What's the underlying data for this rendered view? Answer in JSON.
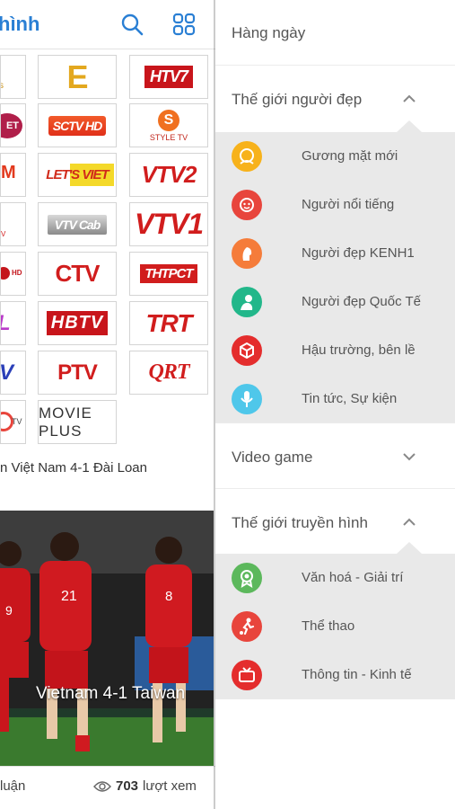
{
  "header": {
    "title": "hình"
  },
  "channels": {
    "row1": [
      "E",
      "HTV7"
    ],
    "row2": [
      "ET",
      "SCTV HD",
      "STYLE TV"
    ],
    "row3": [
      "M",
      "LET'S VIET",
      "VTV2"
    ],
    "row4": [
      "V",
      "VTV Cab",
      "VTV1"
    ],
    "row5": [
      "HD",
      "CTV",
      "THTPCT"
    ],
    "row6": [
      "L",
      "HBTV",
      "TRT"
    ],
    "row7": [
      "V",
      "PTV",
      "QRT"
    ],
    "row8": [
      "TV",
      "MOVIE PLUS"
    ]
  },
  "article": {
    "headline": "n Việt Nam 4-1 Đài Loan",
    "caption": "Vietnam 4-1 Taiwan",
    "comments_label": "luận",
    "views_count": "703",
    "views_label": "lượt xem",
    "jersey_numbers": [
      "9",
      "21",
      "8"
    ]
  },
  "menu": {
    "daily": "Hàng ngày",
    "beauty": {
      "title": "Thế giới người đẹp",
      "items": [
        {
          "label": "Gương mặt mới",
          "icon": "face-icon",
          "color": "#f7b21b"
        },
        {
          "label": "Người nổi tiếng",
          "icon": "star-face-icon",
          "color": "#e8453c"
        },
        {
          "label": "Người đẹp KENH1",
          "icon": "woman-profile-icon",
          "color": "#f57c3a"
        },
        {
          "label": "Người đẹp Quốc Tế",
          "icon": "globe-woman-icon",
          "color": "#22b78a"
        },
        {
          "label": "Hậu trường, bên lề",
          "icon": "box-icon",
          "color": "#e42d2d"
        },
        {
          "label": "Tin tức, Sự kiện",
          "icon": "microphone-icon",
          "color": "#4fc7ea"
        }
      ]
    },
    "video_game": "Video game",
    "tv": {
      "title": "Thế giới truyền hình",
      "items": [
        {
          "label": "Văn hoá - Giải trí",
          "icon": "award-icon",
          "color": "#5cb85c"
        },
        {
          "label": "Thể thao",
          "icon": "soccer-player-icon",
          "color": "#e8453c"
        },
        {
          "label": "Thông tin - Kinh tế",
          "icon": "tv-icon",
          "color": "#e42d2d"
        }
      ]
    }
  }
}
